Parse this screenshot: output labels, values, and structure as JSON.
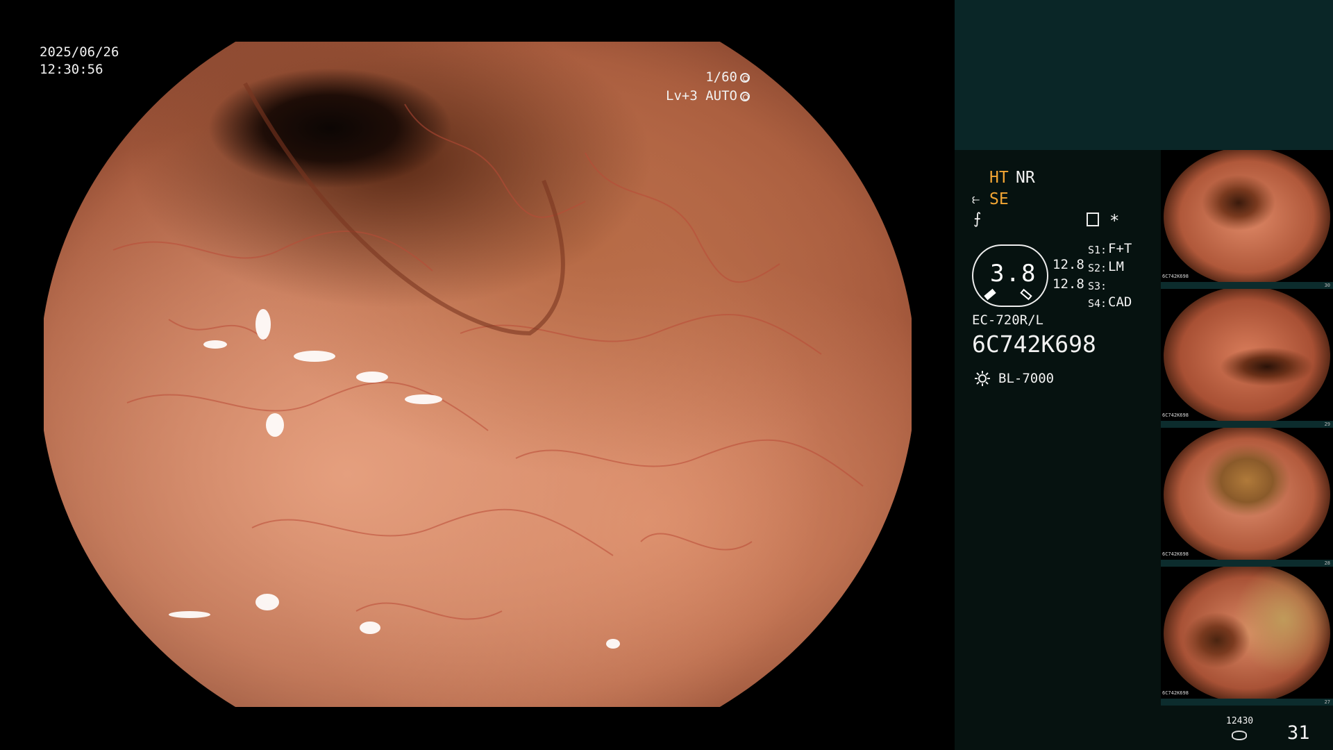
{
  "overlay": {
    "date": "2025/06/26",
    "time": "12:30:56",
    "shutter": "1/60",
    "level": "Lv+3 AUTO"
  },
  "panel": {
    "ht": "HT",
    "nr": "NR",
    "se": "SE",
    "f_symbol": "⨍",
    "star": "*",
    "gauge_value": "3.8",
    "values": [
      "12.8",
      "12.8"
    ],
    "s_labels": [
      "S1:",
      "S2:",
      "S3:",
      "S4:"
    ],
    "s_values": [
      "F+T",
      "LM",
      "",
      "CAD"
    ],
    "scope_model": "EC-720R/L",
    "serial": "6C742K698",
    "light_source": "BL-7000",
    "storage_count": "12430",
    "image_count": "31"
  },
  "thumbnails": [
    {
      "id": "6C742K698",
      "count": "30"
    },
    {
      "id": "6C742K698",
      "count": "29"
    },
    {
      "id": "6C742K698",
      "count": "28"
    },
    {
      "id": "6C742K698",
      "count": "27"
    }
  ],
  "colors": {
    "accent_orange": "#f3a634",
    "panel_top": "#0a2627",
    "panel_body": "#061210"
  }
}
